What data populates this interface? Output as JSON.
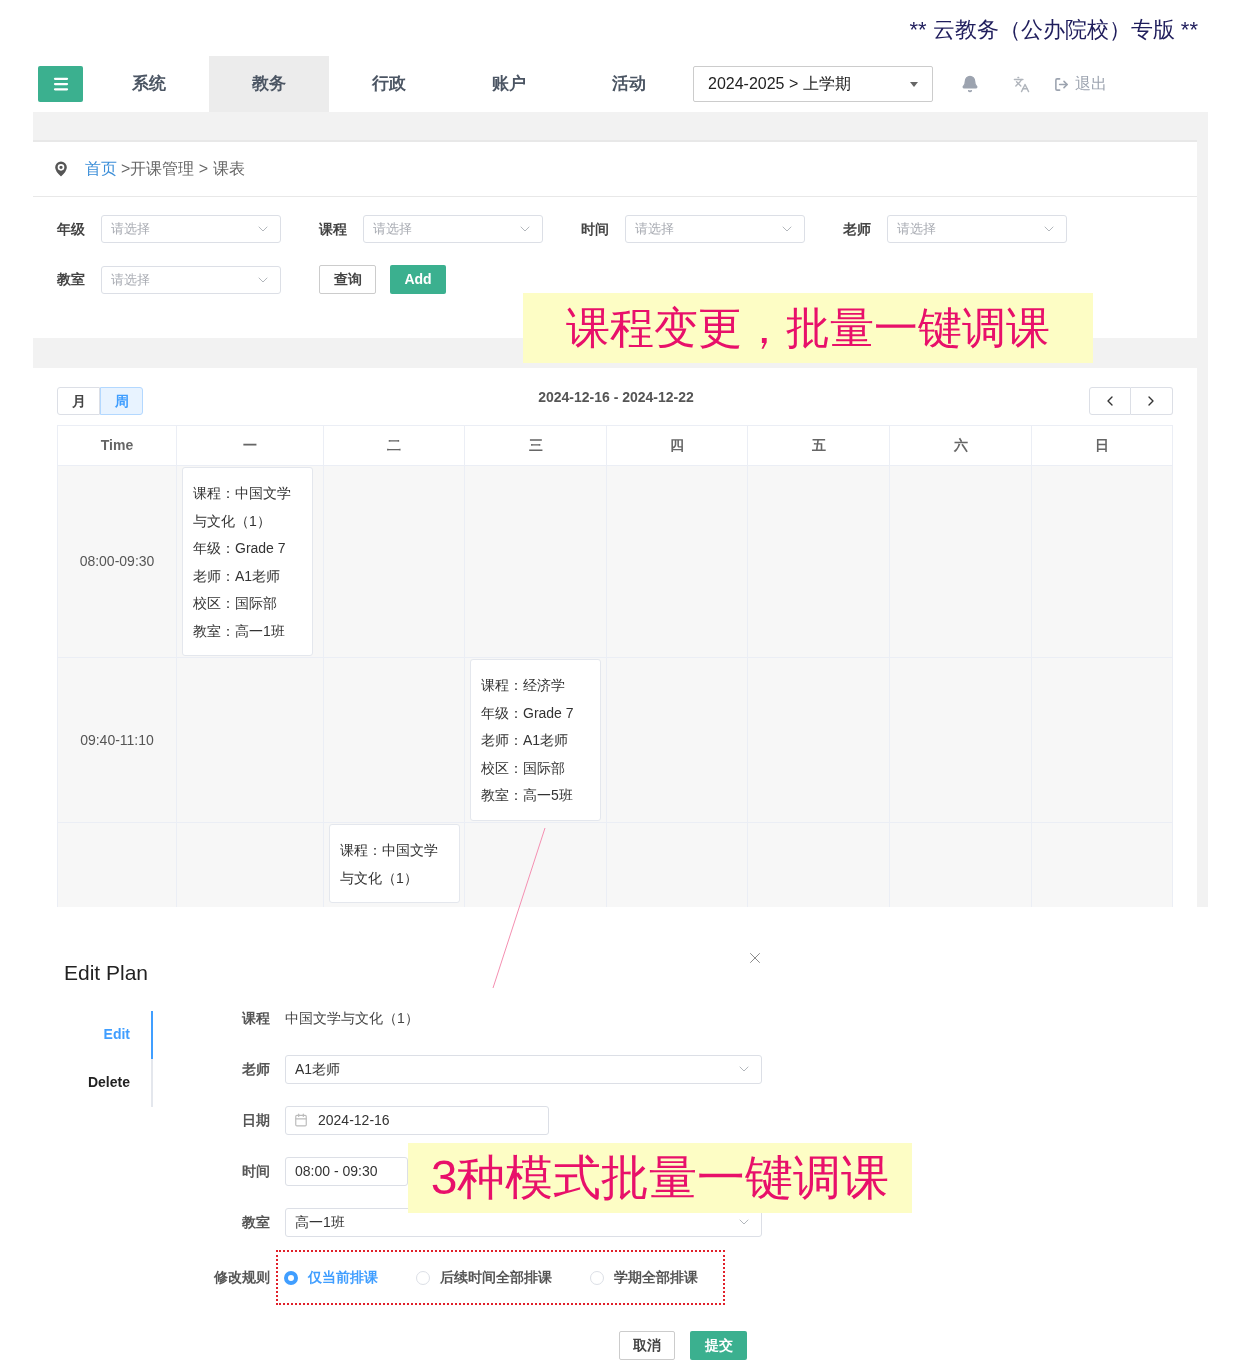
{
  "edition_banner": "** 云教务（公办院校）专版 **",
  "nav": {
    "tabs": [
      {
        "label": "系统",
        "selected": false
      },
      {
        "label": "教务",
        "selected": true
      },
      {
        "label": "行政",
        "selected": false
      },
      {
        "label": "账户",
        "selected": false
      },
      {
        "label": "活动",
        "selected": false
      }
    ],
    "term_select": "2024-2025 > 上学期",
    "logout": "退出"
  },
  "breadcrumb": {
    "home": "首页",
    "path": ">开课管理 > 课表"
  },
  "filters": [
    {
      "label": "年级",
      "placeholder": "请选择"
    },
    {
      "label": "课程",
      "placeholder": "请选择"
    },
    {
      "label": "时间",
      "placeholder": "请选择"
    },
    {
      "label": "老师",
      "placeholder": "请选择"
    },
    {
      "label": "教室",
      "placeholder": "请选择"
    }
  ],
  "filter_buttons": {
    "query": "查询",
    "add": "Add"
  },
  "calendar": {
    "views": [
      {
        "label": "月",
        "selected": false
      },
      {
        "label": "周",
        "selected": true
      }
    ],
    "range": "2024-12-16 - 2024-12-22",
    "columns": [
      "Time",
      "一",
      "二",
      "三",
      "四",
      "五",
      "六",
      "日"
    ],
    "rows": [
      {
        "cells": [
          {
            "kind": "time",
            "text": "08:00-09:30"
          },
          {
            "kind": "event",
            "lines": [
              "课程：中国文学与文化（1）",
              "年级：Grade 7",
              "老师：A1老师",
              "校区：国际部",
              "教室：高一1班"
            ]
          },
          {
            "kind": "empty"
          },
          {
            "kind": "empty"
          },
          {
            "kind": "empty"
          },
          {
            "kind": "empty"
          },
          {
            "kind": "empty"
          },
          {
            "kind": "empty"
          }
        ]
      },
      {
        "cells": [
          {
            "kind": "time",
            "text": "09:40-11:10"
          },
          {
            "kind": "empty"
          },
          {
            "kind": "empty"
          },
          {
            "kind": "event",
            "lines": [
              "课程：经济学",
              "年级：Grade 7",
              "老师：A1老师",
              "校区：国际部",
              "教室：高一5班"
            ]
          },
          {
            "kind": "empty"
          },
          {
            "kind": "empty"
          },
          {
            "kind": "empty"
          },
          {
            "kind": "empty"
          }
        ]
      },
      {
        "cells": [
          {
            "kind": "empty"
          },
          {
            "kind": "empty"
          },
          {
            "kind": "event",
            "lines": [
              "课程：中国文学与文化（1）"
            ]
          },
          {
            "kind": "empty"
          },
          {
            "kind": "empty"
          },
          {
            "kind": "empty"
          },
          {
            "kind": "empty"
          },
          {
            "kind": "empty"
          }
        ]
      }
    ]
  },
  "dialog": {
    "title": "Edit Plan",
    "side_tabs": [
      {
        "label": "Edit",
        "selected": true
      },
      {
        "label": "Delete",
        "selected": false
      }
    ],
    "fields": [
      {
        "kind": "text",
        "label": "课程",
        "value": "中国文学与文化（1）"
      },
      {
        "kind": "select",
        "label": "老师",
        "value": "A1老师"
      },
      {
        "kind": "date",
        "label": "日期",
        "value": "2024-12-16"
      },
      {
        "kind": "input",
        "label": "时间",
        "value": "08:00 - 09:30"
      },
      {
        "kind": "select",
        "label": "教室",
        "value": "高一1班"
      }
    ],
    "rule": {
      "label": "修改规则",
      "options": [
        {
          "label": "仅当前排课",
          "selected": true
        },
        {
          "label": "后续时间全部排课",
          "selected": false
        },
        {
          "label": "学期全部排课",
          "selected": false
        }
      ]
    },
    "buttons": {
      "cancel": "取消",
      "submit": "提交"
    }
  },
  "annotations": [
    "课程变更，批量一键调课",
    "3种模式批量一键调课"
  ]
}
